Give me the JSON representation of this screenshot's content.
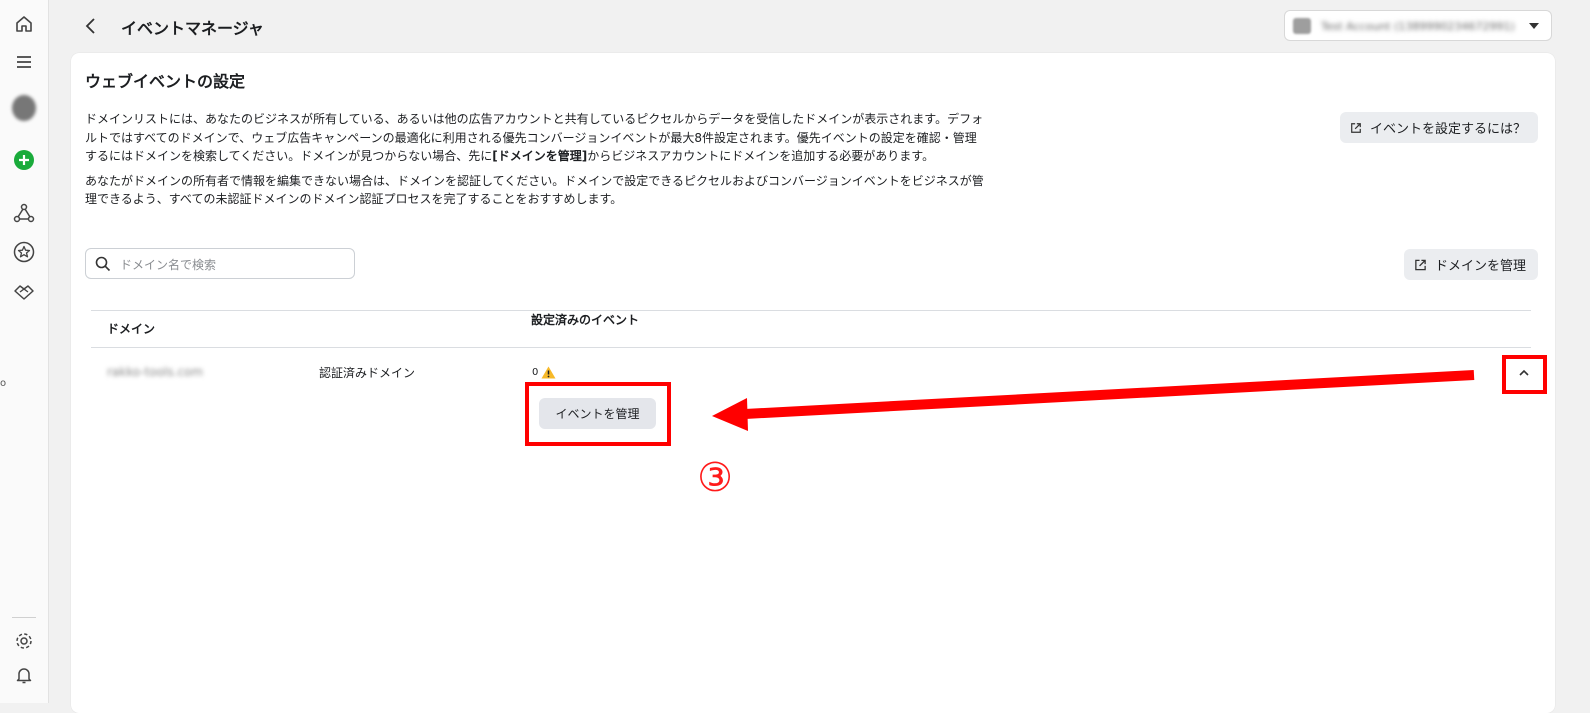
{
  "header": {
    "app_title": "イベントマネージャ",
    "account_name": "Test Account (1389990234672991)"
  },
  "page": {
    "title": "ウェブイベントの設定",
    "desc1_part1": "ドメインリストには、あなたのビジネスが所有している、あるいは他の広告アカウントと共有しているピクセルからデータを受信したドメインが表示されます。デフォルトではすべてのドメインで、ウェブ広告キャンペーンの最適化に利用される優先コンバージョンイベントが最大8件設定されます。優先イベントの設定を確認・管理するにはドメインを検索してください。ドメインが見つからない場合、先に",
    "desc1_bold": "[ドメインを管理]",
    "desc1_part2": "からビジネスアカウントにドメインを追加する必要があります。",
    "desc2": "あなたがドメインの所有者で情報を編集できない場合は、ドメインを認証してください。ドメインで設定できるピクセルおよびコンバージョンイベントをビジネスが管理できるよう、すべての未認証ドメインのドメイン認証プロセスを完了することをおすすめします。",
    "howto_button": "イベントを設定するには？",
    "manage_domains_button": "ドメインを管理",
    "search_placeholder": "ドメイン名で検索"
  },
  "table": {
    "columns": [
      "ドメイン",
      "設定済みのイベント"
    ],
    "rows": [
      {
        "domain": "rakko-tools.com",
        "status": "認証済みドメイン",
        "event_count": "0",
        "manage_button": "イベントを管理"
      }
    ]
  },
  "annotation": {
    "step_number": "③",
    "color": "#ff0000"
  },
  "edge_mark": "o"
}
